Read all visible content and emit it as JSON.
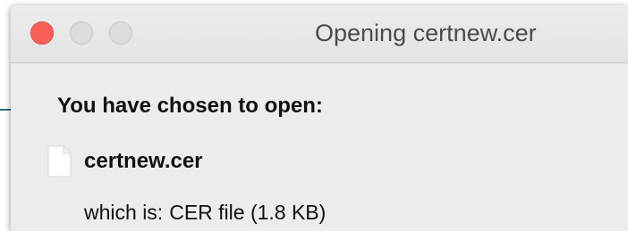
{
  "window": {
    "title": "Opening certnew.cer"
  },
  "dialog": {
    "prompt": "You have chosen to open:",
    "file_name": "certnew.cer",
    "file_icon": "document-icon",
    "type_label": "which is:",
    "type_value": "CER file (1.8 KB)"
  },
  "colors": {
    "close_button": "#fc5f57",
    "inactive_button": "#dcdcdc",
    "window_background": "#ececec",
    "backdrop_accent": "#2b6f73"
  }
}
